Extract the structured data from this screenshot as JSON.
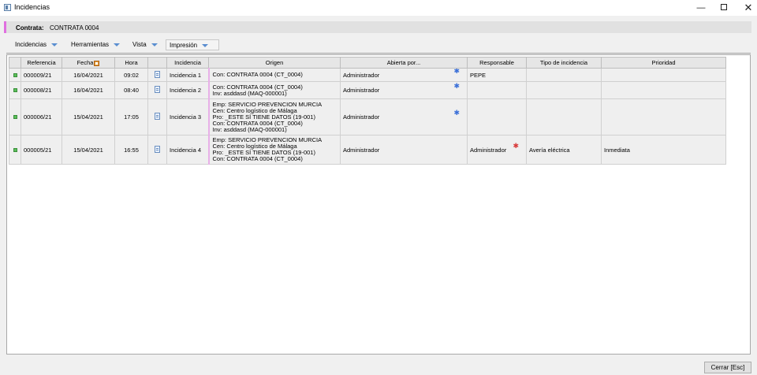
{
  "window": {
    "title": "Incidencias"
  },
  "contract": {
    "label": "Contrata:",
    "value": "CONTRATA 0004"
  },
  "menu": [
    {
      "label": "Incidencias"
    },
    {
      "label": "Herramientas"
    },
    {
      "label": "Vista"
    },
    {
      "label": "Impresión"
    }
  ],
  "table": {
    "headers": [
      "",
      "Referencia",
      "Fecha",
      "Hora",
      "",
      "Incidencia",
      "Origen",
      "Abierta por...",
      "Responsable",
      "Tipo de incidencia",
      "Prioridad"
    ],
    "rows": [
      {
        "referencia": "000009/21",
        "fecha": "16/04/2021",
        "hora": "09:02",
        "incidencia": "Incidencia 1",
        "origen": [
          "Con:  CONTRATA 0004  (CT_0004)"
        ],
        "abierta_por": "Administrador",
        "responsable": "PEPE",
        "tipo": "",
        "prioridad": ""
      },
      {
        "referencia": "000008/21",
        "fecha": "16/04/2021",
        "hora": "08:40",
        "incidencia": "Incidencia 2",
        "origen": [
          "Con:  CONTRATA 0004  (CT_0004)",
          "Inv:  asddasd  (MAQ-000001)"
        ],
        "abierta_por": "Administrador",
        "responsable": "",
        "tipo": "",
        "prioridad": ""
      },
      {
        "referencia": "000006/21",
        "fecha": "15/04/2021",
        "hora": "17:05",
        "incidencia": "Incidencia 3",
        "origen": [
          "Emp:  SERVICIO PREVENCION MURCIA",
          "Cen:  Centro logístico de Málaga",
          "Pro:  _ESTE SÍ TIENE DATOS  (19-001)",
          "Con:  CONTRATA 0004  (CT_0004)",
          "Inv:  asddasd  (MAQ-000001)"
        ],
        "abierta_por": "Administrador",
        "responsable": "",
        "tipo": "",
        "prioridad": ""
      },
      {
        "referencia": "000005/21",
        "fecha": "15/04/2021",
        "hora": "16:55",
        "incidencia": "Incidencia 4",
        "origen": [
          "Emp:  SERVICIO PREVENCION MURCIA",
          "Cen:  Centro logístico de Málaga",
          "Pro:  _ESTE SÍ TIENE DATOS  (19-001)",
          "Con:  CONTRATA 0004  (CT_0004)"
        ],
        "abierta_por": "Administrador",
        "responsable": "Administrador",
        "tipo": "Avería eléctrica",
        "prioridad": "Inmediata"
      }
    ]
  },
  "footer": {
    "close_label": "Cerrar  [Esc]"
  }
}
